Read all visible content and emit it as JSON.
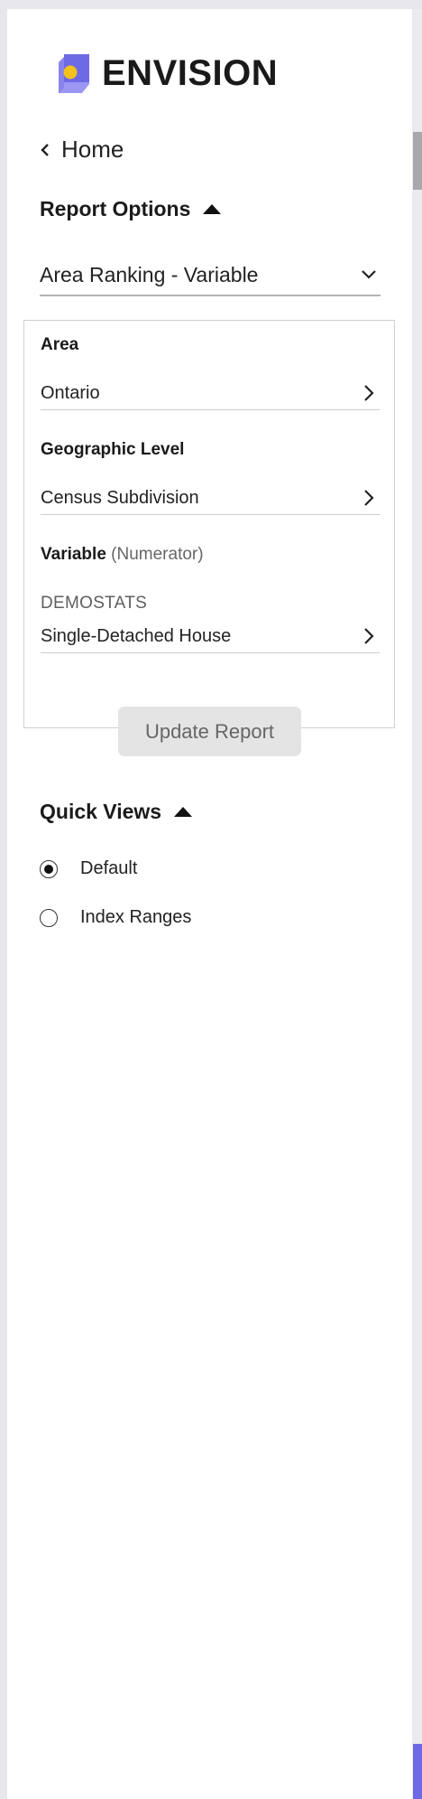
{
  "brand": {
    "name": "ENVISION",
    "colors": {
      "primary": "#6e6ae6",
      "accent": "#f5c11d"
    }
  },
  "nav": {
    "home_label": "Home"
  },
  "report_options": {
    "title": "Report Options",
    "report_type": "Area Ranking - Variable",
    "fields": {
      "area": {
        "label": "Area",
        "value": "Ontario"
      },
      "geo_level": {
        "label": "Geographic Level",
        "value": "Census Subdivision"
      },
      "variable": {
        "label": "Variable",
        "sublabel": "(Numerator)",
        "category": "DEMOSTATS",
        "value": "Single-Detached House"
      }
    },
    "update_button": "Update Report"
  },
  "quick_views": {
    "title": "Quick Views",
    "options": [
      {
        "label": "Default",
        "selected": true
      },
      {
        "label": "Index Ranges",
        "selected": false
      }
    ]
  }
}
